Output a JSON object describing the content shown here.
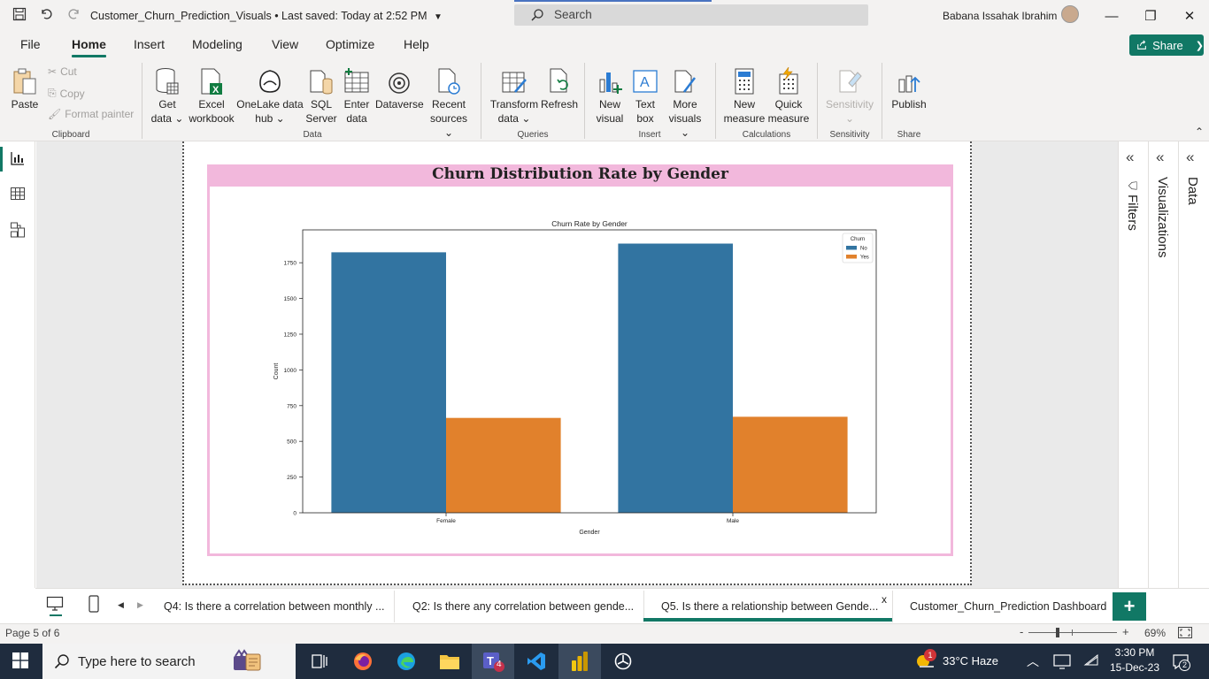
{
  "window": {
    "doc_title": "Customer_Churn_Prediction_Visuals • Last saved: Today at 2:52 PM",
    "search_placeholder": "Search",
    "user_name": "Babana Issahak Ibrahim",
    "controls": {
      "minimize": "—",
      "restore": "❐",
      "close": "✕"
    }
  },
  "menu": {
    "items": [
      "File",
      "Home",
      "Insert",
      "Modeling",
      "View",
      "Optimize",
      "Help"
    ],
    "share_label": "Share"
  },
  "ribbon": {
    "clipboard": {
      "paste": "Paste",
      "cut": "Cut",
      "copy": "Copy",
      "format_painter": "Format painter",
      "group": "Clipboard"
    },
    "data": {
      "get_data": [
        "Get",
        "data ⌄"
      ],
      "excel": [
        "Excel",
        "workbook"
      ],
      "onelake": [
        "OneLake data",
        "hub ⌄"
      ],
      "sql": [
        "SQL",
        "Server"
      ],
      "enter": [
        "Enter",
        "data"
      ],
      "dataverse": [
        "Dataverse",
        ""
      ],
      "recent": [
        "Recent",
        "sources ⌄"
      ],
      "group": "Data"
    },
    "queries": {
      "transform": [
        "Transform",
        "data ⌄"
      ],
      "refresh": [
        "Refresh",
        ""
      ],
      "group": "Queries"
    },
    "insert": {
      "new_visual": [
        "New",
        "visual"
      ],
      "text_box": [
        "Text",
        "box"
      ],
      "more_visuals": [
        "More",
        "visuals ⌄"
      ],
      "group": "Insert"
    },
    "calculations": {
      "new_measure": [
        "New",
        "measure"
      ],
      "quick_measure": [
        "Quick",
        "measure"
      ],
      "group": "Calculations"
    },
    "sensitivity": {
      "label": [
        "Sensitivity",
        "⌄"
      ],
      "group": "Sensitivity"
    },
    "share": {
      "publish": [
        "Publish",
        ""
      ],
      "group": "Share"
    }
  },
  "panes": {
    "filters": "Filters",
    "visualizations": "Visualizations",
    "data": "Data"
  },
  "visual": {
    "title": "Churn Distribution Rate by Gender"
  },
  "chart_data": {
    "type": "bar",
    "title": "Churn Rate by Gender",
    "xlabel": "Gender",
    "ylabel": "Count",
    "categories": [
      "Female",
      "Male"
    ],
    "legend_title": "Churn",
    "legend_position": "top-right",
    "series": [
      {
        "name": "No",
        "color": "#3274a1",
        "values": [
          1823,
          1884
        ]
      },
      {
        "name": "Yes",
        "color": "#e1812c",
        "values": [
          664,
          672
        ]
      }
    ],
    "ylim": [
      0,
      1980
    ],
    "yticks": [
      0,
      250,
      500,
      750,
      1000,
      1250,
      1500,
      1750
    ]
  },
  "tabs": [
    {
      "label": "Q4: Is there a correlation between monthly ...",
      "active": false
    },
    {
      "label": "Q2: Is there any correlation between gende...",
      "active": false
    },
    {
      "label": "Q5. Is there a relationship between Gende...",
      "active": true,
      "close": "x"
    },
    {
      "label": "Customer_Churn_Prediction Dashboard",
      "active": false
    }
  ],
  "add_page": "+",
  "status": {
    "page": "Page 5 of 6",
    "zoom_minus": "-",
    "zoom_plus": "+",
    "zoom": "69%"
  },
  "taskbar": {
    "search_placeholder": "Type here to search",
    "teams_badge": "4",
    "weather": "33°C  Haze",
    "weather_badge": "1",
    "time": "3:30 PM",
    "date": "15-Dec-23",
    "notif_count": "2"
  }
}
